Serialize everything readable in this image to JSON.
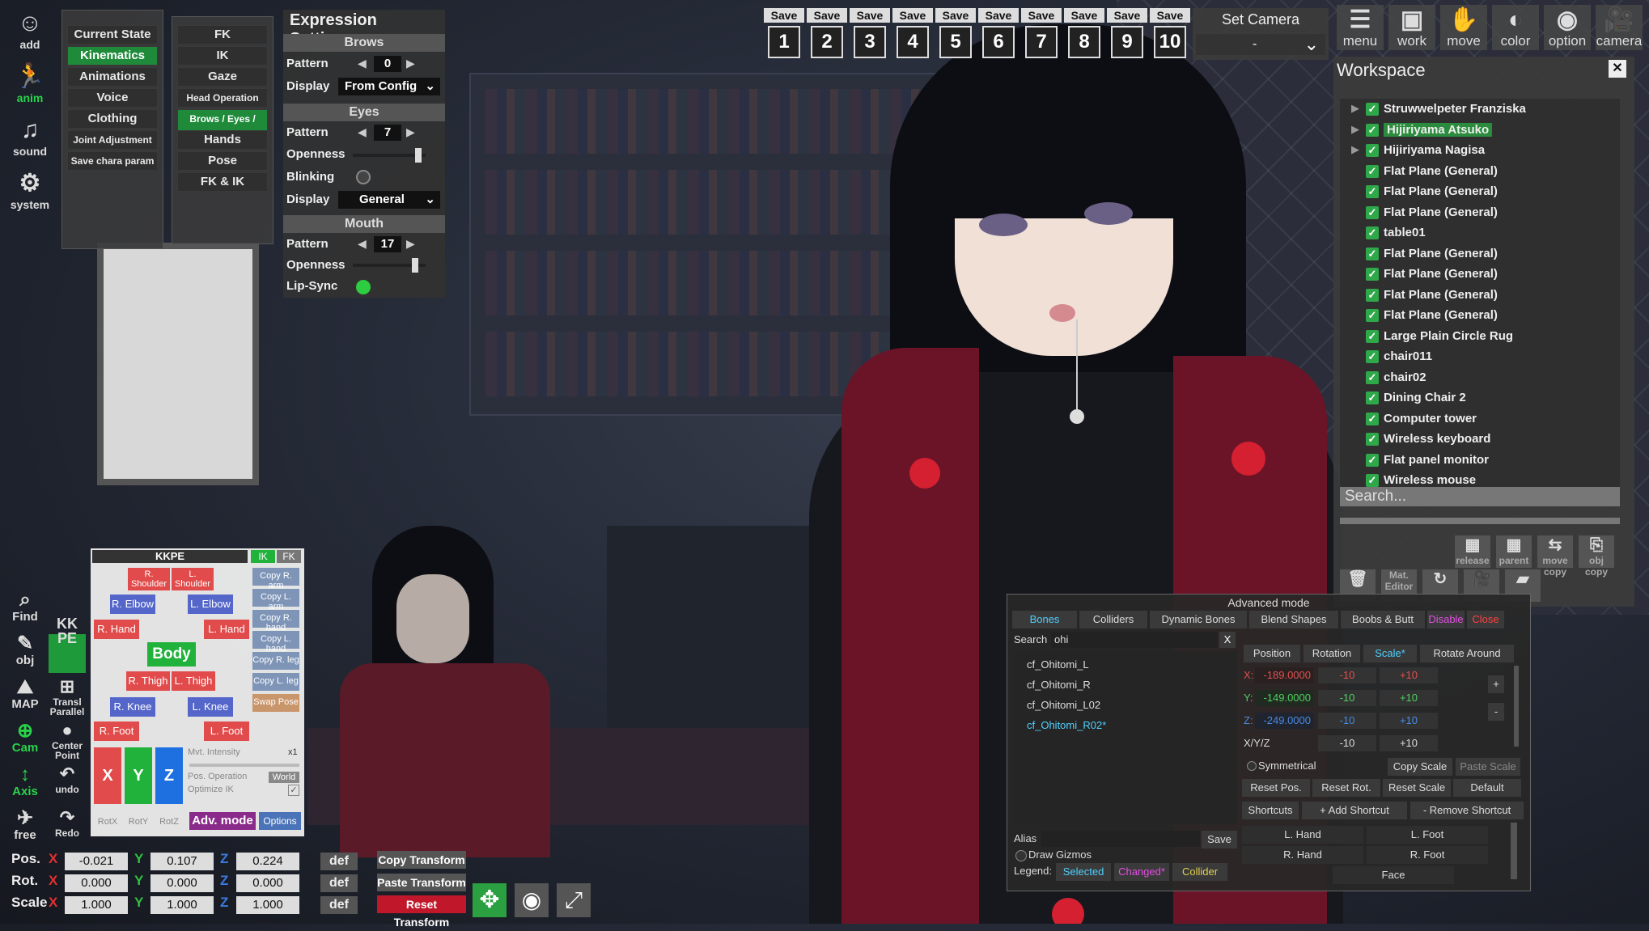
{
  "left_icons": [
    {
      "icon": "add-icon",
      "label": "add"
    },
    {
      "icon": "anim-icon",
      "label": "anim"
    },
    {
      "icon": "sound-icon",
      "label": "sound"
    },
    {
      "icon": "system-icon",
      "label": "system"
    }
  ],
  "left_tools": [
    {
      "icon": "find-icon",
      "label": "Find"
    },
    {
      "icon": "obj-icon",
      "label": "obj"
    },
    {
      "icon": "map-icon",
      "label": "MAP"
    },
    {
      "icon": "cam-icon",
      "label": "Cam"
    },
    {
      "icon": "axis-icon",
      "label": "Axis"
    },
    {
      "icon": "free-icon",
      "label": "free"
    }
  ],
  "left_tools2": [
    {
      "icon": "kkpe-icon",
      "label": "KK PE"
    },
    {
      "icon": "transl-parallel-icon",
      "label": "Transl Parallel"
    },
    {
      "icon": "center-point-icon",
      "label": "Center Point"
    },
    {
      "icon": "undo-icon",
      "label": "undo"
    },
    {
      "icon": "redo-icon",
      "label": "Redo"
    }
  ],
  "menu1": [
    "Current State",
    "Kinematics",
    "Animations",
    "Voice",
    "Clothing",
    "Joint Adjustment",
    "Save chara param"
  ],
  "menu1_selected": "Kinematics",
  "menu2": [
    "FK",
    "IK",
    "Gaze",
    "Head Operation",
    "Brows / Eyes / Mouth",
    "Hands",
    "Pose",
    "FK & IK"
  ],
  "menu2_selected": "Brows / Eyes / Mouth",
  "expression": {
    "title": "Expression Settings",
    "brows": {
      "heading": "Brows",
      "pattern_label": "Pattern",
      "pattern": "0",
      "display_label": "Display",
      "display": "From Config"
    },
    "eyes": {
      "heading": "Eyes",
      "pattern_label": "Pattern",
      "pattern": "7",
      "openness_label": "Openness",
      "openness": 0.9,
      "blinking_label": "Blinking",
      "blinking": false,
      "display_label": "Display",
      "display": "General"
    },
    "mouth": {
      "heading": "Mouth",
      "pattern_label": "Pattern",
      "pattern": "17",
      "openness_label": "Openness",
      "openness": 0.85,
      "lipsync_label": "Lip-Sync",
      "lipsync": true
    }
  },
  "save_slots": {
    "save_label": "Save",
    "numbers": [
      "1",
      "2",
      "3",
      "4",
      "5",
      "6",
      "7",
      "8",
      "9",
      "10"
    ]
  },
  "set_camera": {
    "title": "Set Camera",
    "value": "-"
  },
  "top_right": [
    {
      "icon": "menu-icon",
      "label": "menu"
    },
    {
      "icon": "work-icon",
      "label": "work"
    },
    {
      "icon": "move-icon",
      "label": "move"
    },
    {
      "icon": "color-icon",
      "label": "color"
    },
    {
      "icon": "option-icon",
      "label": "option"
    },
    {
      "icon": "camera-icon",
      "label": "camera"
    }
  ],
  "workspace": {
    "title": "Workspace",
    "close": "✕",
    "items": [
      {
        "name": "Struwwelpeter Franziska",
        "expand": true
      },
      {
        "name": "Hijiriyama Atsuko",
        "expand": true,
        "selected": true
      },
      {
        "name": "Hijiriyama Nagisa",
        "expand": true
      },
      {
        "name": "Flat Plane (General)"
      },
      {
        "name": "Flat Plane (General)"
      },
      {
        "name": "Flat Plane (General)"
      },
      {
        "name": "table01"
      },
      {
        "name": "Flat Plane (General)"
      },
      {
        "name": "Flat Plane (General)"
      },
      {
        "name": "Flat Plane (General)"
      },
      {
        "name": "Flat Plane (General)"
      },
      {
        "name": "Large Plain Circle Rug"
      },
      {
        "name": "chair011"
      },
      {
        "name": "chair02"
      },
      {
        "name": "Dining Chair 2"
      },
      {
        "name": "Computer tower"
      },
      {
        "name": "Wireless keyboard"
      },
      {
        "name": "Flat panel monitor"
      },
      {
        "name": "Wireless mouse"
      }
    ],
    "search_placeholder": "Search...",
    "tools": [
      {
        "icon": "release-icon",
        "label": "release"
      },
      {
        "icon": "parent-icon",
        "label": "parent"
      },
      {
        "icon": "move-copy-icon",
        "label": "move copy"
      },
      {
        "icon": "obj-copy-icon",
        "label": "obj copy"
      },
      {
        "icon": "delete-icon",
        "label": ""
      },
      {
        "icon": "mat-editor-icon",
        "label": "Mat. Editor"
      },
      {
        "icon": "route-icon",
        "label": ""
      },
      {
        "icon": "camera-icon",
        "label": ""
      },
      {
        "icon": "folder-icon",
        "label": ""
      }
    ]
  },
  "kkpe": {
    "title": "KKPE",
    "tab_ik": "IK",
    "tab_fk": "FK",
    "r_shoulder": "R. Shoulder",
    "l_shoulder": "L. Shoulder",
    "r_elbow": "R. Elbow",
    "l_elbow": "L. Elbow",
    "r_hand": "R. Hand",
    "l_hand": "L. Hand",
    "body": "Body",
    "r_thigh": "R. Thigh",
    "l_thigh": "L. Thigh",
    "r_knee": "R. Knee",
    "l_knee": "L. Knee",
    "r_foot": "R. Foot",
    "l_foot": "L. Foot",
    "side": [
      "Copy R. arm",
      "Copy L. arm",
      "Copy R. hand",
      "Copy L. hand",
      "Copy R. leg",
      "Copy L. leg",
      "Swap Pose"
    ],
    "axes": [
      "X",
      "Y",
      "Z"
    ],
    "rot": [
      "RotX",
      "RotY",
      "RotZ"
    ],
    "mvt_label": "Mvt. Intensity",
    "mvt_value": "x1",
    "pos_op": "Pos. Operation",
    "world": "World",
    "optimize": "Optimize IK",
    "adv_mode": "Adv. mode",
    "options": "Options"
  },
  "advanced": {
    "title": "Advanced mode",
    "tabs": [
      "Bones",
      "Colliders",
      "Dynamic Bones",
      "Blend Shapes",
      "Boobs & Butt",
      "Disable",
      "Close"
    ],
    "search_label": "Search",
    "search_value": "ohi",
    "search_clear": "X",
    "bones": [
      "cf_Ohitomi_L",
      "cf_Ohitomi_R",
      "cf_Ohitomi_L02",
      "cf_Ohitomi_R02*"
    ],
    "modes": [
      "Position",
      "Rotation",
      "Scale*",
      "Rotate Around"
    ],
    "x_label": "X:",
    "x_value": "-189.0000",
    "y_label": "Y:",
    "y_value": "-149.0000",
    "z_label": "Z:",
    "z_value": "-249.0000",
    "xyz_label": "X/Y/Z",
    "minus10": "-10",
    "plus10": "+10",
    "plus": "+",
    "minus": "-",
    "symmetrical": "Symmetrical",
    "copy_scale": "Copy Scale",
    "paste_scale": "Paste Scale",
    "reset": [
      "Reset Pos.",
      "Reset Rot.",
      "Reset Scale",
      "Default"
    ],
    "shortcuts": "Shortcuts",
    "add_shortcut": "+ Add Shortcut",
    "remove_shortcut": "- Remove Shortcut",
    "shortcut_items": [
      "L. Hand",
      "L. Foot",
      "R. Hand",
      "R. Foot",
      "Face"
    ],
    "alias_label": "Alias",
    "save": "Save",
    "draw_gizmos": "Draw Gizmos",
    "legend_label": "Legend:",
    "legend_selected": "Selected",
    "legend_changed": "Changed*",
    "legend_collider": "Collider"
  },
  "transform": {
    "pos_label": "Pos.",
    "rot_label": "Rot.",
    "scale_label": "Scale",
    "axes": [
      "X",
      "Y",
      "Z"
    ],
    "pos": [
      "-0.021",
      "0.107",
      "0.224"
    ],
    "rot": [
      "0.000",
      "0.000",
      "0.000"
    ],
    "scale": [
      "1.000",
      "1.000",
      "1.000"
    ],
    "def": "def",
    "copy": "Copy Transform",
    "paste": "Paste Transform",
    "reset": "Reset Transform"
  }
}
